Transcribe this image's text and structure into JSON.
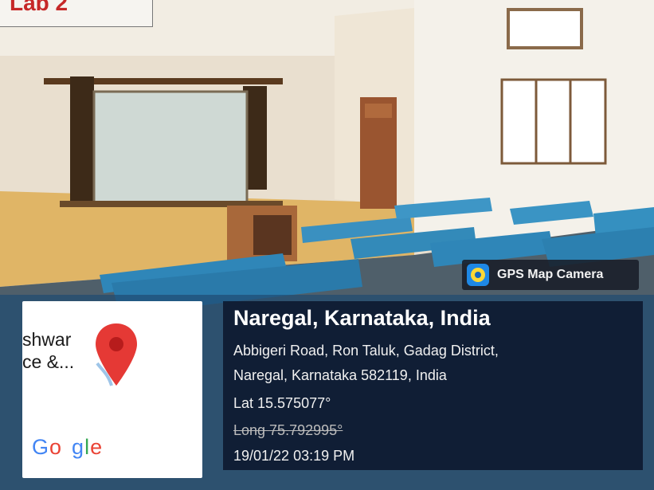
{
  "photo_label": "Lab 2",
  "gps_badge": {
    "label": "GPS Map Camera",
    "icon": "gps-map-camera-icon"
  },
  "map_thumb": {
    "place_line1": "shwar",
    "place_line2": "ce &...",
    "google_letters": [
      "G",
      "o",
      "g",
      "l",
      "e"
    ],
    "google_colors": [
      "#4285F4",
      "#EA4335",
      "#FBBC05",
      "#4285F4",
      "#EA4335"
    ],
    "pin_color": "#e53935"
  },
  "location": {
    "title": "Naregal, Karnataka, India",
    "address_line1": "Abbigeri Road, Ron Taluk, Gadag District,",
    "address_line2": "Naregal, Karnataka 582119, India",
    "latitude": "Lat 15.575077°",
    "longitude": "Long 75.792995°",
    "datetime": "19/01/22 03:19 PM"
  }
}
